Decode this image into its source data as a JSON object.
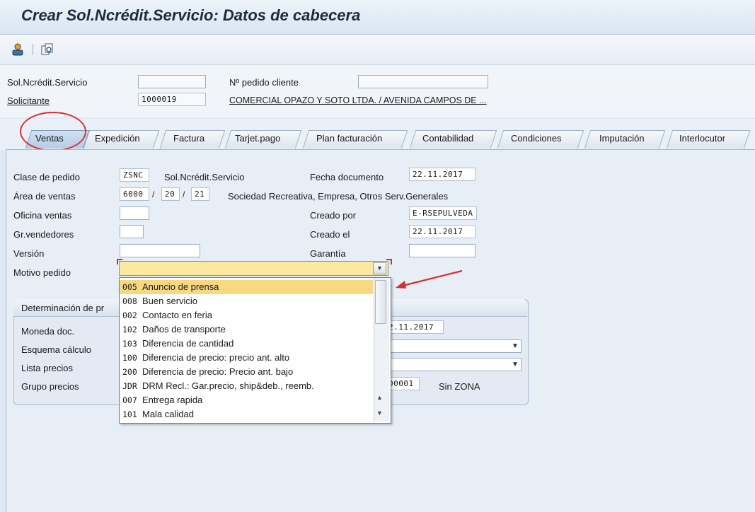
{
  "window": {
    "title": "Crear Sol.Ncrédit.Servicio: Datos de cabecera"
  },
  "toolbar": {
    "icons": [
      "person-icon",
      "overview-icon"
    ]
  },
  "header": {
    "doc_label": "Sol.Ncrédit.Servicio",
    "doc_value": "",
    "po_label": "Nº pedido cliente",
    "po_value": "",
    "sold_to_label": "Solicitante",
    "sold_to_value": "1000019",
    "sold_to_name": "COMERCIAL OPAZO Y SOTO LTDA. / AVENIDA CAMPOS DE ..."
  },
  "tabs": [
    "Ventas",
    "Expedición",
    "Factura",
    "Tarjet.pago",
    "Plan facturación",
    "Contabilidad",
    "Condiciones",
    "Imputación",
    "Interlocutor"
  ],
  "active_tab": "Ventas",
  "sales": {
    "order_type_label": "Clase de pedido",
    "order_type_value": "ZSNC",
    "order_type_desc": "Sol.Ncrédit.Servicio",
    "doc_date_label": "Fecha documento",
    "doc_date_value": "22.11.2017",
    "sales_area_label": "Área de ventas",
    "sales_org": "6000",
    "dist_channel": "20",
    "division": "21",
    "sep": "/",
    "sales_area_desc": "Sociedad Recreativa, Empresa, Otros Serv.Generales",
    "office_label": "Oficina ventas",
    "office_value": "",
    "created_by_label": "Creado por",
    "created_by_value": "E-RSEPULVEDA",
    "group_label": "Gr.vendedores",
    "group_value": "",
    "created_on_label": "Creado el",
    "created_on_value": "22.11.2017",
    "version_label": "Versión",
    "version_value": "",
    "warranty_label": "Garantía",
    "warranty_value": "",
    "reason_label": "Motivo pedido",
    "reason_value": ""
  },
  "pricing": {
    "header": "Determinación de pr",
    "currency_label": "Moneda doc.",
    "procedure_label": "Esquema cálculo",
    "price_list_label": "Lista precios",
    "price_group_label": "Grupo precios",
    "date_value": "2.11.2017",
    "price_group_value": "00001",
    "price_group_desc": "Sin ZONA"
  },
  "reason_dropdown": [
    {
      "code": "005",
      "text": "Anuncio de prensa",
      "selected": true
    },
    {
      "code": "008",
      "text": "Buen servicio"
    },
    {
      "code": "002",
      "text": "Contacto en feria"
    },
    {
      "code": "102",
      "text": "Daños de transporte"
    },
    {
      "code": "103",
      "text": "Diferencia de cantidad"
    },
    {
      "code": "100",
      "text": "Diferencia de precio: precio ant. alto"
    },
    {
      "code": "200",
      "text": "Diferencia de precio: Precio ant. bajo"
    },
    {
      "code": "JDR",
      "text": "DRM Recl.: Gar.precio, ship&deb., reemb."
    },
    {
      "code": "007",
      "text": "Entrega rapida"
    },
    {
      "code": "101",
      "text": "Mala calidad"
    }
  ],
  "colors": {
    "highlight_selected": "#f8d880",
    "annotation_red": "#d6302f",
    "combo_focus": "#fde8a0"
  }
}
